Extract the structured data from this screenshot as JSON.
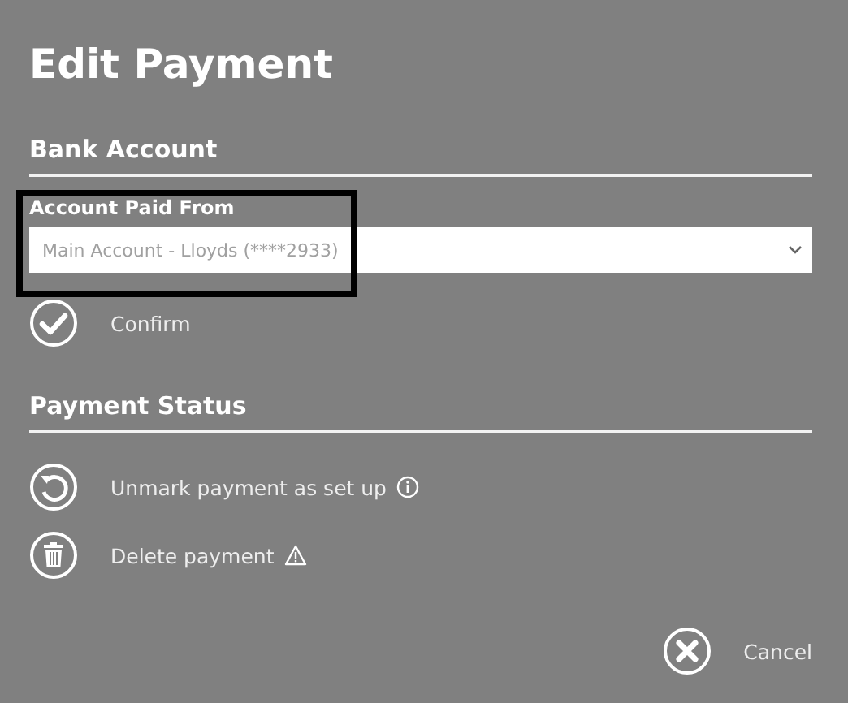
{
  "title": "Edit Payment",
  "bank_account": {
    "heading": "Bank Account",
    "field": {
      "label": "Account Paid From",
      "value": "Main Account - Lloyds (****2933)",
      "highlighted": true
    },
    "actions": [
      {
        "kind": "confirm",
        "label": "Confirm"
      }
    ]
  },
  "payment_status": {
    "heading": "Payment Status",
    "actions": [
      {
        "kind": "unmark",
        "label": "Unmark payment as set up"
      },
      {
        "kind": "delete",
        "label": "Delete payment"
      }
    ]
  },
  "footer": {
    "actions": [
      {
        "kind": "cancel",
        "label": "Cancel"
      }
    ]
  }
}
